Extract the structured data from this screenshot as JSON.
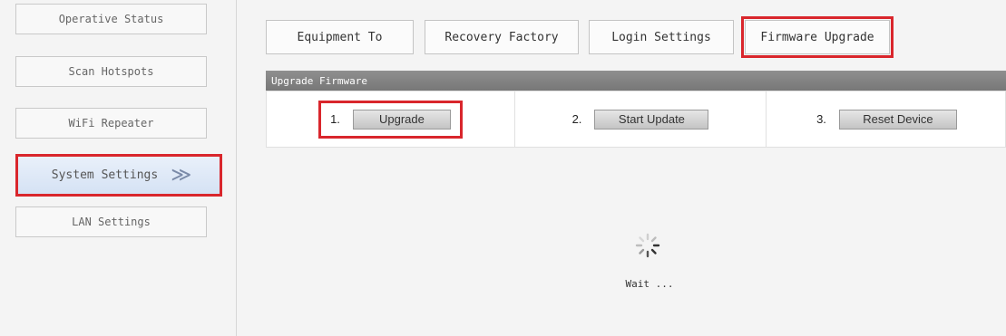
{
  "sidebar": {
    "items": [
      {
        "label": "Operative Status"
      },
      {
        "label": "Scan Hotspots"
      },
      {
        "label": "WiFi Repeater"
      },
      {
        "label": "System Settings",
        "active": true,
        "chevron": "≫"
      },
      {
        "label": "LAN Settings"
      }
    ]
  },
  "tabs": [
    {
      "label": "Equipment To"
    },
    {
      "label": "Recovery Factory"
    },
    {
      "label": "Login Settings"
    },
    {
      "label": "Firmware Upgrade",
      "highlighted": true
    }
  ],
  "section": {
    "title": "Upgrade Firmware",
    "steps": [
      {
        "num": "1.",
        "button": "Upgrade"
      },
      {
        "num": "2.",
        "button": "Start Update"
      },
      {
        "num": "3.",
        "button": "Reset Device"
      }
    ]
  },
  "status": {
    "icon": "spinner-icon",
    "text": "Wait ..."
  },
  "colors": {
    "highlight": "#d9262c",
    "section_bar": "#7f7f7f",
    "active_nav": "#d5e2f4"
  }
}
